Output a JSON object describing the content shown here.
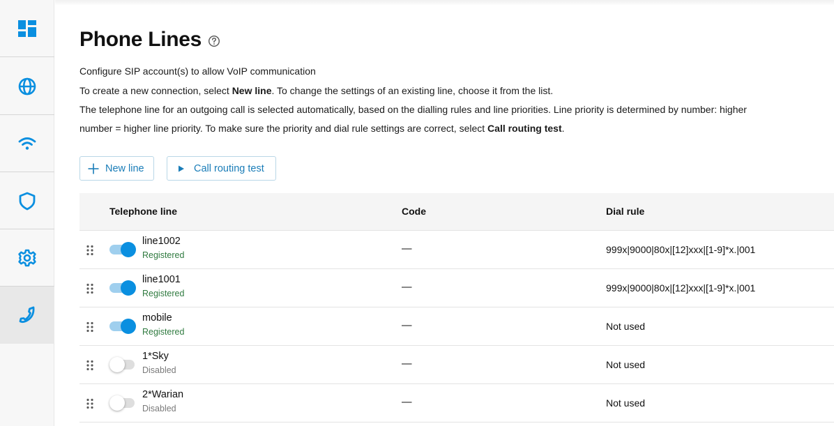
{
  "sidebar": {
    "items": [
      {
        "name": "dashboard",
        "icon": "dashboard-icon"
      },
      {
        "name": "internet",
        "icon": "globe-icon"
      },
      {
        "name": "wifi",
        "icon": "wifi-icon"
      },
      {
        "name": "security",
        "icon": "shield-icon"
      },
      {
        "name": "settings",
        "icon": "gear-icon"
      },
      {
        "name": "telephony",
        "icon": "phone-icon",
        "active": true
      }
    ]
  },
  "header": {
    "title": "Phone Lines"
  },
  "description": {
    "line1": "Configure SIP account(s) to allow VoIP communication",
    "line2_before": "To create a new connection, select ",
    "line2_bold": "New line",
    "line2_after": ". To change the settings of an existing line, choose it from the list.",
    "line3": "The telephone line for an outgoing call is selected automatically, based on the dialling rules and line priorities. Line priority is determined by number: higher",
    "line4_before": "number = higher line priority. To make sure the priority and dial rule settings are correct, select ",
    "line4_bold": "Call routing test",
    "line4_after": "."
  },
  "toolbar": {
    "new_line_label": "New line",
    "call_routing_label": "Call routing test"
  },
  "table": {
    "columns": {
      "line": "Telephone line",
      "code": "Code",
      "dial_rule": "Dial rule"
    },
    "rows": [
      {
        "name": "line1002",
        "status": "Registered",
        "enabled": true,
        "code": "—",
        "dial_rule": "999x|9000|80x|[12]xxx|[1-9]*x.|001"
      },
      {
        "name": "line1001",
        "status": "Registered",
        "enabled": true,
        "code": "—",
        "dial_rule": "999x|9000|80x|[12]xxx|[1-9]*x.|001"
      },
      {
        "name": "mobile",
        "status": "Registered",
        "enabled": true,
        "code": "—",
        "dial_rule": "Not used"
      },
      {
        "name": "1*Sky",
        "status": "Disabled",
        "enabled": false,
        "code": "—",
        "dial_rule": "Not used"
      },
      {
        "name": "2*Warian",
        "status": "Disabled",
        "enabled": false,
        "code": "—",
        "dial_rule": "Not used"
      }
    ]
  },
  "colors": {
    "accent": "#0a8fe0",
    "registered": "#2f7a3f",
    "disabled": "#7a7a7a",
    "button_text": "#1a7db8"
  }
}
